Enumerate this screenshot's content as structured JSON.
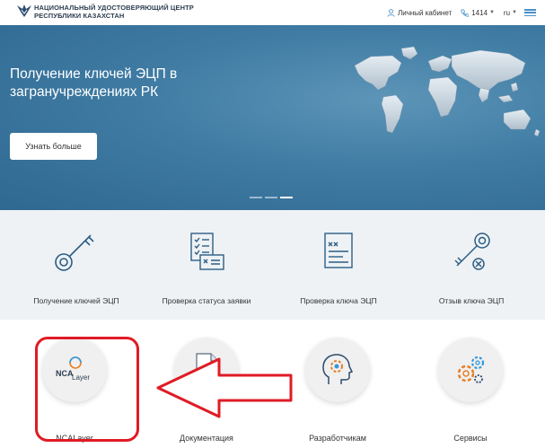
{
  "header": {
    "brand_line1": "НАЦИОНАЛЬНЫЙ УДОСТОВЕРЯЮЩИЙ ЦЕНТР",
    "brand_line2": "РЕСПУБЛИКИ КАЗАХСТАН",
    "cabinet_label": "Личный кабинет",
    "phone_label": "1414",
    "lang_label": "ru",
    "icons": [
      "logo-icon",
      "user-icon",
      "phone-icon",
      "chevron-down-icon",
      "menu-icon"
    ]
  },
  "hero": {
    "title": "Получение ключей ЭЦП в загранучреждениях РК",
    "button_label": "Узнать больше",
    "slides_total": 3,
    "slide_active": 3
  },
  "services": [
    {
      "label": "Получение ключей ЭЦП",
      "icon": "key-icon"
    },
    {
      "label": "Проверка статуса заявки",
      "icon": "checklist-icon"
    },
    {
      "label": "Проверка ключа ЭЦП",
      "icon": "key-check-icon"
    },
    {
      "label": "Отзыв ключа ЭЦП",
      "icon": "key-revoke-icon"
    }
  ],
  "cards": [
    {
      "label": "NCALayer",
      "icon": "ncalayer-logo-icon",
      "logo_text_top": "NCA",
      "logo_text_bottom": "Layer"
    },
    {
      "label": "Документация",
      "icon": "document-icon"
    },
    {
      "label": "Разработчикам",
      "icon": "developer-head-icon"
    },
    {
      "label": "Сервисы",
      "icon": "gears-icon"
    }
  ],
  "annotation": {
    "highlight_color": "#e01b24",
    "target": "NCALayer"
  },
  "colors": {
    "hero_bg": "#3f7ba3",
    "accent": "#4a90c8",
    "service_bg": "#eef2f5",
    "annotation_red": "#e01b24"
  }
}
